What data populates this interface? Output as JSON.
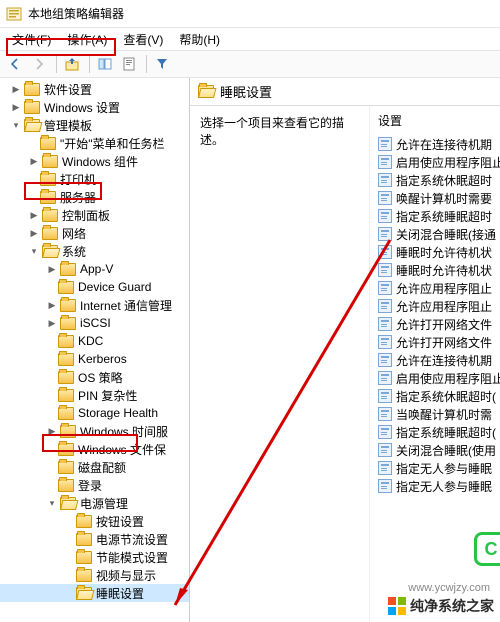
{
  "window": {
    "title": "本地组策略编辑器"
  },
  "menu": {
    "file": "文件(F)",
    "action": "操作(A)",
    "view": "查看(V)",
    "help": "帮助(H)"
  },
  "tree": {
    "n0": {
      "label": "软件设置"
    },
    "n1": {
      "label": "Windows 设置"
    },
    "n2": {
      "label": "管理模板"
    },
    "n3": {
      "label": "\"开始\"菜单和任务栏"
    },
    "n4": {
      "label": "Windows 组件"
    },
    "n5": {
      "label": "打印机"
    },
    "n6": {
      "label": "服务器"
    },
    "n7": {
      "label": "控制面板"
    },
    "n8": {
      "label": "网络"
    },
    "n9": {
      "label": "系统"
    },
    "n10": {
      "label": "App-V"
    },
    "n11": {
      "label": "Device Guard"
    },
    "n12": {
      "label": "Internet 通信管理"
    },
    "n13": {
      "label": "iSCSI"
    },
    "n14": {
      "label": "KDC"
    },
    "n15": {
      "label": "Kerberos"
    },
    "n16": {
      "label": "OS 策略"
    },
    "n17": {
      "label": "PIN 复杂性"
    },
    "n18": {
      "label": "Storage Health"
    },
    "n19": {
      "label": "Windows 时间服"
    },
    "n20": {
      "label": "Windows 文件保"
    },
    "n21": {
      "label": "磁盘配额"
    },
    "n22": {
      "label": "登录"
    },
    "n23": {
      "label": "电源管理"
    },
    "n24": {
      "label": "按钮设置"
    },
    "n25": {
      "label": "电源节流设置"
    },
    "n26": {
      "label": "节能模式设置"
    },
    "n27": {
      "label": "视频与显示"
    },
    "n28": {
      "label": "睡眠设置"
    }
  },
  "right": {
    "header": "睡眠设置",
    "description": "选择一个项目来查看它的描述。",
    "settings_header": "设置",
    "items": {
      "s0": "允许在连接待机期",
      "s1": "启用使应用程序阻止",
      "s2": "指定系统休眠超时",
      "s3": "唤醒计算机时需要",
      "s4": "指定系统睡眠超时",
      "s5": "关闭混合睡眠(接通",
      "s6": "睡眠时允许待机状",
      "s7": "睡眠时允许待机状",
      "s8": "允许应用程序阻止",
      "s9": "允许应用程序阻止",
      "s10": "允许打开网络文件",
      "s11": "允许打开网络文件",
      "s12": "允许在连接待机期",
      "s13": "启用使应用程序阻止",
      "s14": "指定系统休眠超时(",
      "s15": "当唤醒计算机时需",
      "s16": "指定系统睡眠超时(",
      "s17": "关闭混合睡眠(使用",
      "s18": "指定无人参与睡眠",
      "s19": "指定无人参与睡眠"
    }
  },
  "watermark": {
    "text": "纯净系统之家",
    "url": "www.ycwjzy.com"
  }
}
